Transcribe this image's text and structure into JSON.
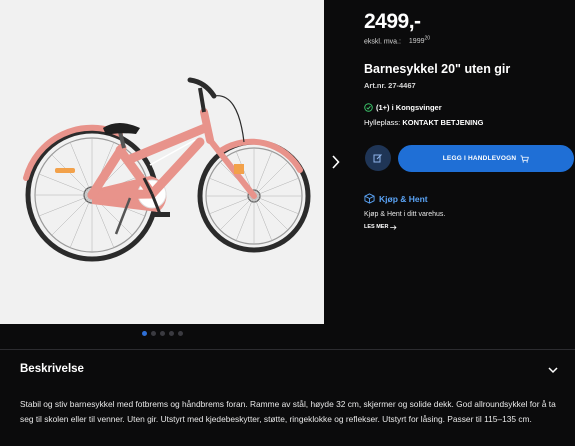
{
  "product": {
    "price": "2499,-",
    "exvat_label": "ekskl. mva.:",
    "exvat_value": "1999",
    "exvat_cents": "20",
    "title": "Barnesykkel 20\" uten gir",
    "art_nr": "Art.nr. 27-4467",
    "stock": "(1+) i Kongsvinger",
    "shelf_label": "Hylleplass:",
    "shelf_value": "KONTAKT BETJENING"
  },
  "actions": {
    "add_to_cart": "LEGG I HANDLEVOGN"
  },
  "pickup": {
    "title": "Kjøp & Hent",
    "text": "Kjøp & Hent i ditt varehus.",
    "read_more": "LES MER"
  },
  "gallery": {
    "slides": 5,
    "active_slide": 1
  },
  "description": {
    "title": "Beskrivelse",
    "text": "Stabil og stiv barnesykkel med fotbrems og håndbrems foran. Ramme av stål, høyde 32 cm, skjermer og solide dekk. God allroundsykkel for å ta seg til skolen eller til venner. Uten gir. Utstyrt med kjedebeskytter, støtte, ringeklokke og reflekser. Utstyrt for låsing. Passer til 115–135 cm."
  },
  "colors": {
    "background": "#0b0b0c",
    "accent": "#1f6fd6",
    "pickup_link": "#5aa3f5",
    "stock_ok": "#3cc46a",
    "bike_frame": "#e8938b"
  },
  "icons": [
    "chevron-right-icon",
    "check-circle-icon",
    "compare-icon",
    "cart-icon",
    "box-icon",
    "arrow-right-icon",
    "chevron-down-icon"
  ]
}
